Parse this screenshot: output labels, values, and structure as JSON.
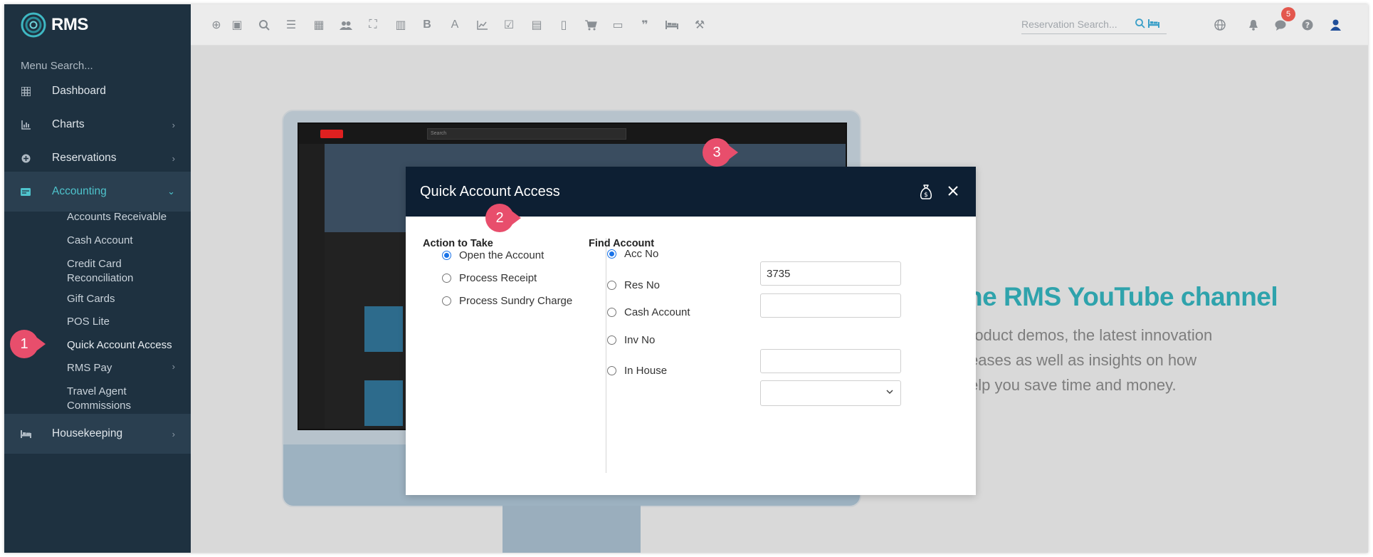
{
  "app": {
    "name": "RMS"
  },
  "sidebar": {
    "menu_search_placeholder": "Menu Search...",
    "items": [
      {
        "label": "Dashboard",
        "icon": "dashboard-icon"
      },
      {
        "label": "Charts",
        "icon": "chart-icon"
      },
      {
        "label": "Reservations",
        "icon": "reservations-icon"
      },
      {
        "label": "Accounting",
        "icon": "accounting-icon"
      },
      {
        "label": "Housekeeping",
        "icon": "bed-icon"
      }
    ],
    "accounting_sub": [
      "Accounts Receivable",
      "Cash Account",
      "Credit Card Reconciliation",
      "Gift Cards",
      "POS Lite",
      "Quick Account Access",
      "RMS Pay",
      "Travel Agent Commissions"
    ]
  },
  "topbar": {
    "reservation_search_placeholder": "Reservation Search...",
    "notification_count": "5"
  },
  "background": {
    "promo_title": "he RMS YouTube channel",
    "promo_lines": [
      "roduct demos, the latest innovation",
      "eases as well as insights on how",
      "elp you save time and money."
    ],
    "youtube_search": "Search"
  },
  "modal": {
    "title": "Quick Account Access",
    "action_heading": "Action to Take",
    "actions": [
      "Open the Account",
      "Process Receipt",
      "Process Sundry Charge"
    ],
    "selected_action": "Open the Account",
    "find_heading": "Find Account",
    "find_options": [
      "Acc No",
      "Res No",
      "Cash Account",
      "Inv No",
      "In House"
    ],
    "selected_find": "Acc No",
    "acc_no_value": "3735"
  },
  "callouts": [
    "1",
    "2",
    "3"
  ],
  "colors": {
    "sidebar_bg": "#1e3140",
    "accent": "#4ec3cc",
    "modal_header_bg": "#0d1f33",
    "callout": "#e84e6c"
  }
}
